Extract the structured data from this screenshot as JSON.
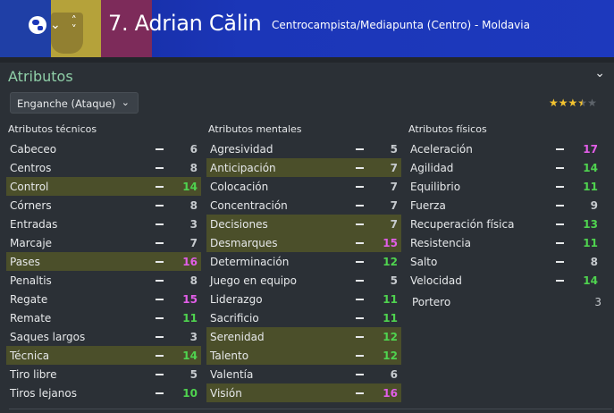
{
  "header": {
    "player_name": "7. Adrian Călin",
    "meta": "Centrocampista/Mediapunta (Centro) - Moldavia",
    "flag_colors": [
      "#1f3fa6",
      "#b5a23a",
      "#7d2b5a"
    ],
    "icons": [
      "globe-icon",
      "chevron-down-icon",
      "up-down-arrows-icon"
    ]
  },
  "panel": {
    "title": "Atributos",
    "collapse_icon": "chevron-down-icon",
    "role": "Enganche (Ataque)",
    "rating_stars": 3.5,
    "rating_max": 5
  },
  "colors": {
    "highlight_row": "#4b4f2a",
    "green_value": "#4fd34f",
    "pink_value": "#e25ee8",
    "title_green": "#8fcfa8"
  },
  "columns": [
    {
      "title": "Atributos técnicos",
      "rows": [
        {
          "label": "Cabeceo",
          "value": "6",
          "hl": false,
          "tone": "def"
        },
        {
          "label": "Centros",
          "value": "8",
          "hl": false,
          "tone": "def"
        },
        {
          "label": "Control",
          "value": "14",
          "hl": true,
          "tone": "green"
        },
        {
          "label": "Córners",
          "value": "8",
          "hl": false,
          "tone": "def"
        },
        {
          "label": "Entradas",
          "value": "3",
          "hl": false,
          "tone": "def"
        },
        {
          "label": "Marcaje",
          "value": "7",
          "hl": false,
          "tone": "def"
        },
        {
          "label": "Pases",
          "value": "16",
          "hl": true,
          "tone": "pink"
        },
        {
          "label": "Penaltis",
          "value": "8",
          "hl": false,
          "tone": "def"
        },
        {
          "label": "Regate",
          "value": "15",
          "hl": false,
          "tone": "pink"
        },
        {
          "label": "Remate",
          "value": "11",
          "hl": false,
          "tone": "green"
        },
        {
          "label": "Saques largos",
          "value": "3",
          "hl": false,
          "tone": "def"
        },
        {
          "label": "Técnica",
          "value": "14",
          "hl": true,
          "tone": "green"
        },
        {
          "label": "Tiro libre",
          "value": "5",
          "hl": false,
          "tone": "def"
        },
        {
          "label": "Tiros lejanos",
          "value": "10",
          "hl": false,
          "tone": "green"
        }
      ]
    },
    {
      "title": "Atributos mentales",
      "rows": [
        {
          "label": "Agresividad",
          "value": "5",
          "hl": false,
          "tone": "def"
        },
        {
          "label": "Anticipación",
          "value": "7",
          "hl": true,
          "tone": "def"
        },
        {
          "label": "Colocación",
          "value": "7",
          "hl": false,
          "tone": "def"
        },
        {
          "label": "Concentración",
          "value": "7",
          "hl": false,
          "tone": "def"
        },
        {
          "label": "Decisiones",
          "value": "7",
          "hl": true,
          "tone": "def"
        },
        {
          "label": "Desmarques",
          "value": "15",
          "hl": true,
          "tone": "pink"
        },
        {
          "label": "Determinación",
          "value": "12",
          "hl": false,
          "tone": "green"
        },
        {
          "label": "Juego en equipo",
          "value": "5",
          "hl": false,
          "tone": "def"
        },
        {
          "label": "Liderazgo",
          "value": "11",
          "hl": false,
          "tone": "green"
        },
        {
          "label": "Sacrificio",
          "value": "11",
          "hl": false,
          "tone": "green"
        },
        {
          "label": "Serenidad",
          "value": "12",
          "hl": true,
          "tone": "green"
        },
        {
          "label": "Talento",
          "value": "12",
          "hl": true,
          "tone": "green"
        },
        {
          "label": "Valentía",
          "value": "6",
          "hl": false,
          "tone": "def"
        },
        {
          "label": "Visión",
          "value": "16",
          "hl": true,
          "tone": "pink"
        }
      ]
    },
    {
      "title": "Atributos físicos",
      "rows": [
        {
          "label": "Aceleración",
          "value": "17",
          "hl": false,
          "tone": "pink"
        },
        {
          "label": "Agilidad",
          "value": "14",
          "hl": false,
          "tone": "green"
        },
        {
          "label": "Equilibrio",
          "value": "11",
          "hl": false,
          "tone": "green"
        },
        {
          "label": "Fuerza",
          "value": "9",
          "hl": false,
          "tone": "def"
        },
        {
          "label": "Recuperación física",
          "value": "13",
          "hl": false,
          "tone": "green"
        },
        {
          "label": "Resistencia",
          "value": "11",
          "hl": false,
          "tone": "green"
        },
        {
          "label": "Salto",
          "value": "8",
          "hl": false,
          "tone": "def"
        },
        {
          "label": "Velocidad",
          "value": "14",
          "hl": false,
          "tone": "green"
        }
      ]
    }
  ],
  "goalkeeper": {
    "label": "Portero",
    "value": "3"
  }
}
